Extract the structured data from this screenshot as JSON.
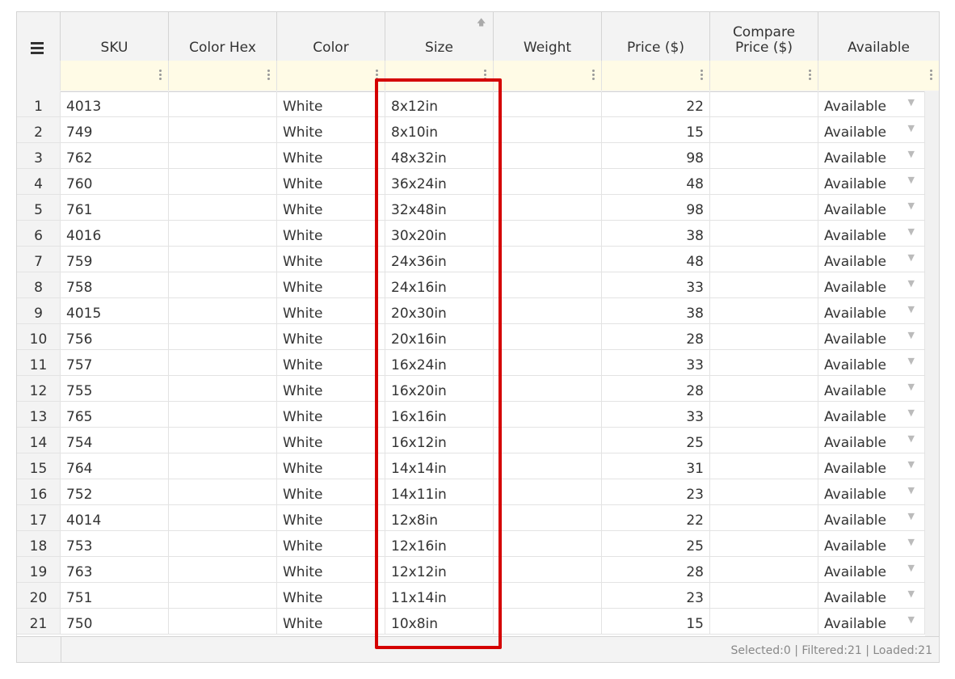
{
  "columns": [
    "SKU",
    "Color Hex",
    "Color",
    "Size",
    "Weight",
    "Price ($)",
    "Compare\nPrice ($)",
    "Available"
  ],
  "columns_display": {
    "sku": "SKU",
    "color_hex": "Color Hex",
    "color": "Color",
    "size": "Size",
    "weight": "Weight",
    "price": "Price ($)",
    "compare_line1": "Compare",
    "compare_line2": "Price ($)",
    "available": "Available"
  },
  "icons": {
    "menu": "hamburger-menu-icon",
    "sort": "sort-arrow-up-icon",
    "filter_menu": "vertical-dots-icon",
    "dropdown": "triangle-down-icon"
  },
  "rows": [
    {
      "n": "1",
      "sku": "4013",
      "hex": "",
      "color": "White",
      "size": "8x12in",
      "weight": "",
      "price": "22",
      "compare": "",
      "available": "Available"
    },
    {
      "n": "2",
      "sku": "749",
      "hex": "",
      "color": "White",
      "size": "8x10in",
      "weight": "",
      "price": "15",
      "compare": "",
      "available": "Available"
    },
    {
      "n": "3",
      "sku": "762",
      "hex": "",
      "color": "White",
      "size": "48x32in",
      "weight": "",
      "price": "98",
      "compare": "",
      "available": "Available"
    },
    {
      "n": "4",
      "sku": "760",
      "hex": "",
      "color": "White",
      "size": "36x24in",
      "weight": "",
      "price": "48",
      "compare": "",
      "available": "Available"
    },
    {
      "n": "5",
      "sku": "761",
      "hex": "",
      "color": "White",
      "size": "32x48in",
      "weight": "",
      "price": "98",
      "compare": "",
      "available": "Available"
    },
    {
      "n": "6",
      "sku": "4016",
      "hex": "",
      "color": "White",
      "size": "30x20in",
      "weight": "",
      "price": "38",
      "compare": "",
      "available": "Available"
    },
    {
      "n": "7",
      "sku": "759",
      "hex": "",
      "color": "White",
      "size": "24x36in",
      "weight": "",
      "price": "48",
      "compare": "",
      "available": "Available"
    },
    {
      "n": "8",
      "sku": "758",
      "hex": "",
      "color": "White",
      "size": "24x16in",
      "weight": "",
      "price": "33",
      "compare": "",
      "available": "Available"
    },
    {
      "n": "9",
      "sku": "4015",
      "hex": "",
      "color": "White",
      "size": "20x30in",
      "weight": "",
      "price": "38",
      "compare": "",
      "available": "Available"
    },
    {
      "n": "10",
      "sku": "756",
      "hex": "",
      "color": "White",
      "size": "20x16in",
      "weight": "",
      "price": "28",
      "compare": "",
      "available": "Available"
    },
    {
      "n": "11",
      "sku": "757",
      "hex": "",
      "color": "White",
      "size": "16x24in",
      "weight": "",
      "price": "33",
      "compare": "",
      "available": "Available"
    },
    {
      "n": "12",
      "sku": "755",
      "hex": "",
      "color": "White",
      "size": "16x20in",
      "weight": "",
      "price": "28",
      "compare": "",
      "available": "Available"
    },
    {
      "n": "13",
      "sku": "765",
      "hex": "",
      "color": "White",
      "size": "16x16in",
      "weight": "",
      "price": "33",
      "compare": "",
      "available": "Available"
    },
    {
      "n": "14",
      "sku": "754",
      "hex": "",
      "color": "White",
      "size": "16x12in",
      "weight": "",
      "price": "25",
      "compare": "",
      "available": "Available"
    },
    {
      "n": "15",
      "sku": "764",
      "hex": "",
      "color": "White",
      "size": "14x14in",
      "weight": "",
      "price": "31",
      "compare": "",
      "available": "Available"
    },
    {
      "n": "16",
      "sku": "752",
      "hex": "",
      "color": "White",
      "size": "14x11in",
      "weight": "",
      "price": "23",
      "compare": "",
      "available": "Available"
    },
    {
      "n": "17",
      "sku": "4014",
      "hex": "",
      "color": "White",
      "size": "12x8in",
      "weight": "",
      "price": "22",
      "compare": "",
      "available": "Available"
    },
    {
      "n": "18",
      "sku": "753",
      "hex": "",
      "color": "White",
      "size": "12x16in",
      "weight": "",
      "price": "25",
      "compare": "",
      "available": "Available"
    },
    {
      "n": "19",
      "sku": "763",
      "hex": "",
      "color": "White",
      "size": "12x12in",
      "weight": "",
      "price": "28",
      "compare": "",
      "available": "Available"
    },
    {
      "n": "20",
      "sku": "751",
      "hex": "",
      "color": "White",
      "size": "11x14in",
      "weight": "",
      "price": "23",
      "compare": "",
      "available": "Available"
    },
    {
      "n": "21",
      "sku": "750",
      "hex": "",
      "color": "White",
      "size": "10x8in",
      "weight": "",
      "price": "15",
      "compare": "",
      "available": "Available"
    }
  ],
  "footer": {
    "status": "Selected:0 | Filtered:21 | Loaded:21"
  },
  "colors": {
    "highlight": "#d40000",
    "filter_bg": "#fffbe6",
    "header_bg": "#f3f3f3"
  }
}
